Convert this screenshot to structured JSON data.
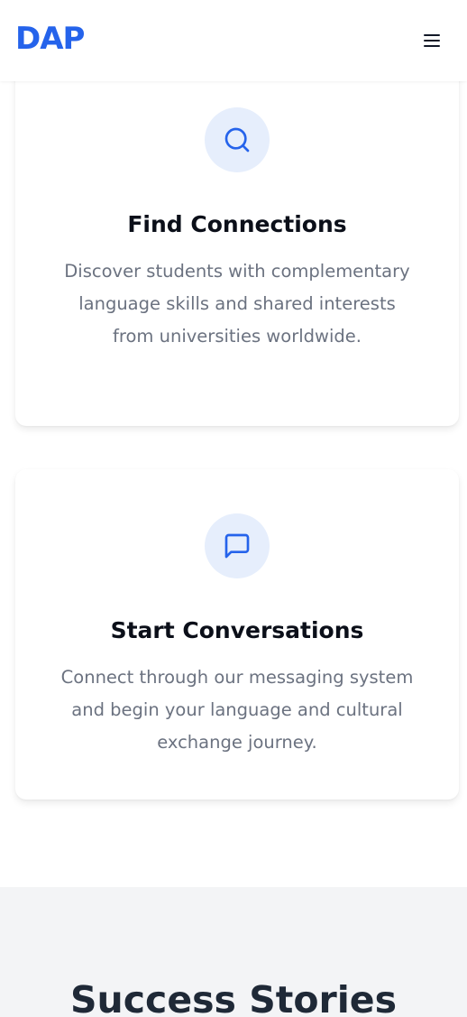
{
  "header": {
    "logo": "DAP",
    "menu_icon": "hamburger-menu-icon"
  },
  "features": [
    {
      "icon": "search-icon",
      "title": "Find Connections",
      "description": "Discover students with complementary language skills and shared interests from universities worldwide."
    },
    {
      "icon": "chat-bubble-icon",
      "title": "Start Conversations",
      "description": "Connect through our messaging system and begin your language and cultural exchange journey."
    }
  ],
  "stories": {
    "title": "Success Stories"
  },
  "colors": {
    "brand": "#2563eb",
    "icon_bg": "#e6eefc",
    "text_muted": "#6b7280",
    "section_bg": "#f3f4f6"
  }
}
